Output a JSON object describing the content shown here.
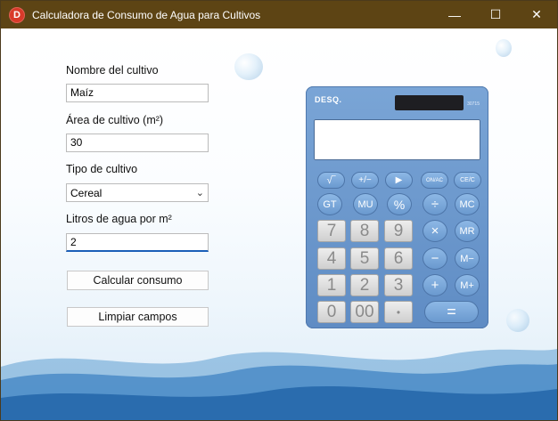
{
  "window": {
    "title": "Calculadora de Consumo de Agua para Cultivos",
    "icon_letter": "D",
    "min": "—",
    "max": "☐",
    "close": "✕"
  },
  "form": {
    "crop_name_label": "Nombre del cultivo",
    "crop_name_value": "Maíz",
    "area_label": "Área de cultivo (m²)",
    "area_value": "30",
    "type_label": "Tipo de cultivo",
    "type_value": "Cereal",
    "liters_label": "Litros de agua por m²",
    "liters_value": "2",
    "calculate_button": "Calcular consumo",
    "clear_button": "Limpiar campos"
  },
  "calculator": {
    "brand": "DESQ.",
    "model": "30715",
    "keys": {
      "sqrt": "√‾",
      "plusminus": "+/−",
      "play": "▶",
      "onac": "ON/AC",
      "cec": "CE/C",
      "gt": "GT",
      "mu": "MU",
      "percent": "%",
      "divide": "÷",
      "mc": "MC",
      "n7": "7",
      "n8": "8",
      "n9": "9",
      "times": "×",
      "mr": "MR",
      "n4": "4",
      "n5": "5",
      "n6": "6",
      "minus": "−",
      "mminus": "M−",
      "n1": "1",
      "n2": "2",
      "n3": "3",
      "plus": "+",
      "mplus": "M+",
      "n0": "0",
      "n00": "00",
      "dot": "•",
      "equals": "="
    }
  }
}
